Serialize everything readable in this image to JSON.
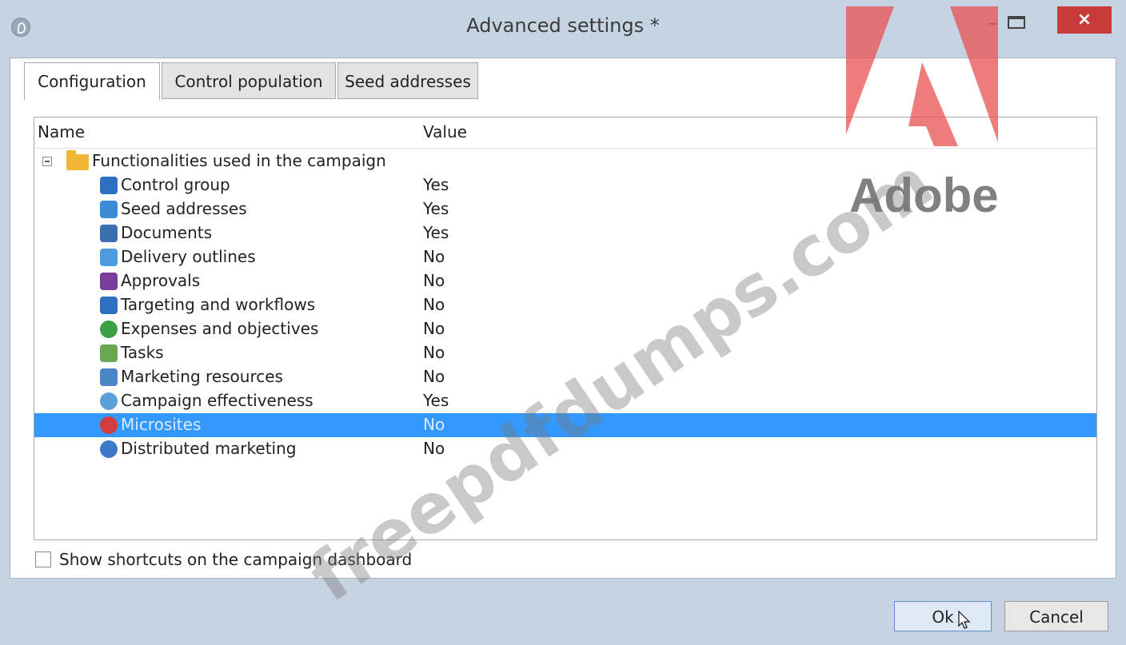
{
  "window": {
    "title": "Advanced settings *",
    "close_glyph": "×",
    "min_glyph": "–"
  },
  "tabs": [
    {
      "label": "Configuration",
      "active": true
    },
    {
      "label": "Control population",
      "active": false
    },
    {
      "label": "Seed addresses",
      "active": false
    }
  ],
  "list": {
    "headers": {
      "name": "Name",
      "value": "Value"
    },
    "group": {
      "label": "Functionalities used in the campaign",
      "icon": "folder-icon"
    },
    "rows": [
      {
        "name": "Control group",
        "value": "Yes",
        "icon": "control-group-icon",
        "color": "#2f6fc2",
        "selected": false
      },
      {
        "name": "Seed addresses",
        "value": "Yes",
        "icon": "seed-addresses-icon",
        "color": "#3a8ad6",
        "selected": false
      },
      {
        "name": "Documents",
        "value": "Yes",
        "icon": "documents-icon",
        "color": "#3a6fb0",
        "selected": false
      },
      {
        "name": "Delivery outlines",
        "value": "No",
        "icon": "delivery-outlines-icon",
        "color": "#4e9be0",
        "selected": false
      },
      {
        "name": "Approvals",
        "value": "No",
        "icon": "approvals-icon",
        "color": "#7a3d9c",
        "selected": false
      },
      {
        "name": "Targeting and workflows",
        "value": "No",
        "icon": "targeting-workflows-icon",
        "color": "#2f6fc2",
        "selected": false
      },
      {
        "name": "Expenses and objectives",
        "value": "No",
        "icon": "expenses-objectives-icon",
        "color": "#3aa043",
        "selected": false
      },
      {
        "name": "Tasks",
        "value": "No",
        "icon": "tasks-icon",
        "color": "#6aa84f",
        "selected": false
      },
      {
        "name": "Marketing resources",
        "value": "No",
        "icon": "marketing-resources-icon",
        "color": "#4a86c5",
        "selected": false
      },
      {
        "name": "Campaign effectiveness",
        "value": "Yes",
        "icon": "campaign-effectiveness-icon",
        "color": "#5aa0d8",
        "selected": false
      },
      {
        "name": "Microsites",
        "value": "No",
        "icon": "microsites-icon",
        "color": "#d23c3c",
        "selected": true
      },
      {
        "name": "Distributed marketing",
        "value": "No",
        "icon": "distributed-marketing-icon",
        "color": "#3a7ac8",
        "selected": false
      }
    ]
  },
  "checkbox": {
    "label": "Show shortcuts on the campaign dashboard",
    "checked": false
  },
  "buttons": {
    "ok": "Ok",
    "cancel": "Cancel"
  },
  "overlay": {
    "logo_text": "Adobe",
    "logo_color": "#e8504f",
    "watermark": "freepdfdumps.com"
  },
  "colors": {
    "selection": "#3399ff",
    "titlebar": "#c6d3e3",
    "close": "#c73b3b"
  }
}
